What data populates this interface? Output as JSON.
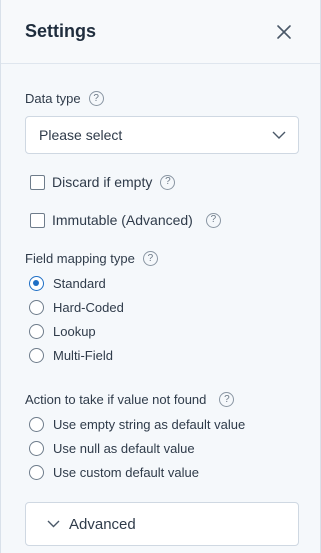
{
  "header": {
    "title": "Settings"
  },
  "data_type": {
    "label": "Data type",
    "placeholder": "Please select"
  },
  "options": {
    "discard_if_empty": "Discard if empty",
    "immutable": "Immutable (Advanced)"
  },
  "field_mapping": {
    "label": "Field mapping type",
    "choices": [
      "Standard",
      "Hard-Coded",
      "Lookup",
      "Multi-Field"
    ],
    "selected": "Standard"
  },
  "not_found": {
    "label": "Action to take if value not found",
    "choices": [
      "Use empty string as default value",
      "Use null as default value",
      "Use custom default value"
    ]
  },
  "advanced": {
    "label": "Advanced"
  },
  "help_glyph": "?",
  "colors": {
    "accent": "#1f6fc5",
    "panel_bg": "#f5f8fb",
    "border": "#cfd8e2"
  }
}
